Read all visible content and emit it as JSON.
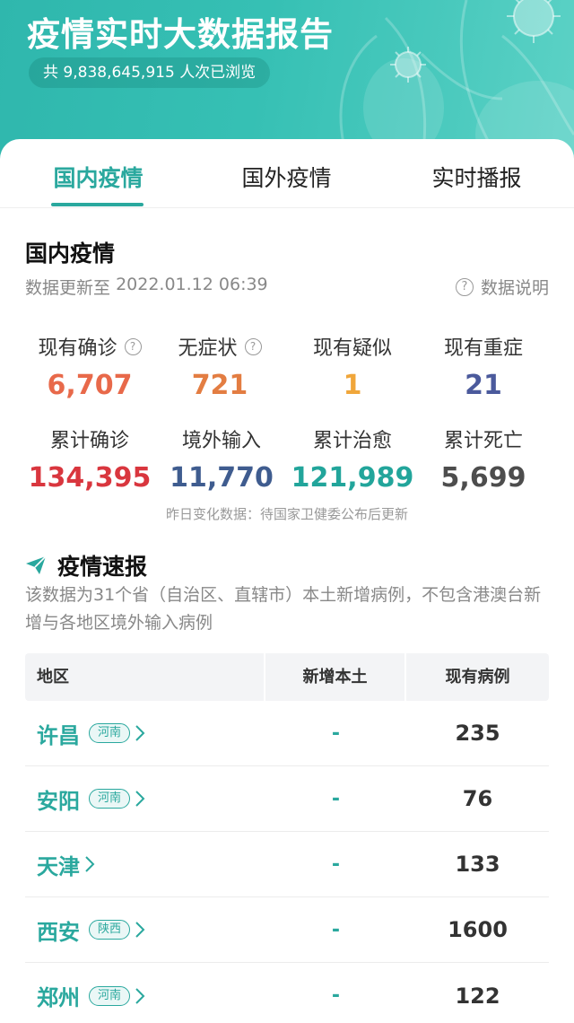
{
  "header": {
    "title": "疫情实时大数据报告",
    "views_prefix": "共",
    "views_count": "9,838,645,915",
    "views_suffix": "人次已浏览"
  },
  "tabs": [
    {
      "label": "国内疫情",
      "active": true
    },
    {
      "label": "国外疫情",
      "active": false
    },
    {
      "label": "实时播报",
      "active": false
    }
  ],
  "section": {
    "title": "国内疫情",
    "update_prefix": "数据更新至",
    "update_time": "2022.01.12 06:39",
    "explain_label": "数据说明"
  },
  "stats": [
    {
      "label": "现有确诊",
      "value": "6,707",
      "color": "#e8694a",
      "help": true
    },
    {
      "label": "无症状",
      "value": "721",
      "color": "#e37d42",
      "help": true
    },
    {
      "label": "现有疑似",
      "value": "1",
      "color": "#f0a63a",
      "help": false
    },
    {
      "label": "现有重症",
      "value": "21",
      "color": "#4b5a9c",
      "help": false
    },
    {
      "label": "累计确诊",
      "value": "134,395",
      "color": "#d9363e",
      "help": false
    },
    {
      "label": "境外输入",
      "value": "11,770",
      "color": "#3f5c8f",
      "help": false
    },
    {
      "label": "累计治愈",
      "value": "121,989",
      "color": "#22a59b",
      "help": false
    },
    {
      "label": "累计死亡",
      "value": "5,699",
      "color": "#4d4d4d",
      "help": false
    }
  ],
  "footnote": "昨日变化数据：待国家卫健委公布后更新",
  "brief": {
    "title": "疫情速报",
    "description": "该数据为31个省（自治区、直辖市）本土新增病例，不包含港澳台新增与各地区境外输入病例"
  },
  "table": {
    "headers": [
      "地区",
      "新增本土",
      "现有病例"
    ],
    "rows": [
      {
        "city": "许昌",
        "province": "河南",
        "new_local": "-",
        "current": "235"
      },
      {
        "city": "安阳",
        "province": "河南",
        "new_local": "-",
        "current": "76"
      },
      {
        "city": "天津",
        "province": "",
        "new_local": "-",
        "current": "133"
      },
      {
        "city": "西安",
        "province": "陕西",
        "new_local": "-",
        "current": "1600"
      },
      {
        "city": "郑州",
        "province": "河南",
        "new_local": "-",
        "current": "122"
      }
    ]
  },
  "colors": {
    "accent": "#2aa89e",
    "header_gradient_start": "#2fb7ad",
    "header_gradient_end": "#5dd2c6"
  },
  "icons": {
    "help": "question-circle-icon",
    "brief": "paper-plane-icon",
    "row_arrow": "chevron-right-icon"
  }
}
